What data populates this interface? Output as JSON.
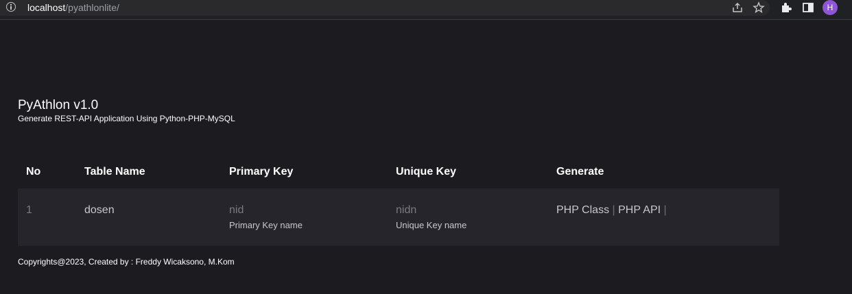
{
  "browser": {
    "url_host": "localhost",
    "url_path": "/pyathlonlite/",
    "avatar_letter": "H"
  },
  "header": {
    "title": "PyAthlon v1.0",
    "subtitle": "Generate REST-API Application Using Python-PHP-MySQL"
  },
  "table": {
    "columns": [
      "No",
      "Table Name",
      "Primary Key",
      "Unique Key",
      "Generate"
    ],
    "rows": [
      {
        "no": "1",
        "table_name": "dosen",
        "primary_key": "nid",
        "primary_key_hint": "Primary Key name",
        "unique_key": "nidn",
        "unique_key_hint": "Unique Key name",
        "generate_links": [
          "PHP Class",
          "PHP API"
        ],
        "separator": "|"
      }
    ]
  },
  "footer": {
    "text": "Copyrights@2023, Created by : Freddy Wicaksono, M.Kom"
  }
}
